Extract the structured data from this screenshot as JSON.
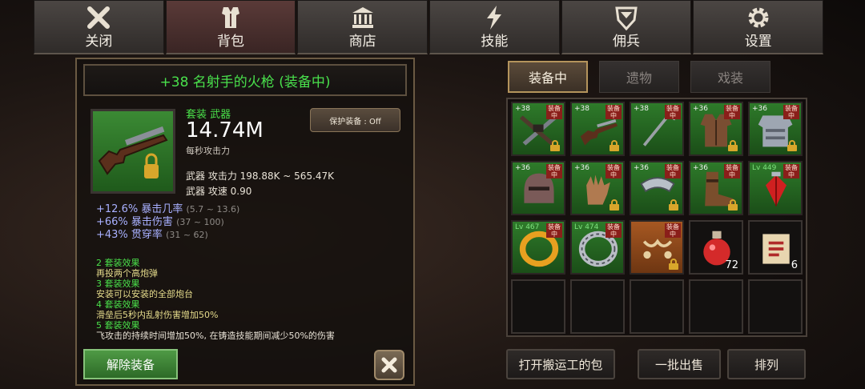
{
  "nav": [
    {
      "label": "关闭",
      "icon": "close-icon"
    },
    {
      "label": "背包",
      "icon": "armor-icon"
    },
    {
      "label": "商店",
      "icon": "temple-icon"
    },
    {
      "label": "技能",
      "icon": "lightning-icon"
    },
    {
      "label": "佣兵",
      "icon": "shield-icon"
    },
    {
      "label": "设置",
      "icon": "gear-icon"
    }
  ],
  "active_nav": "背包",
  "item": {
    "title": "+38 名射手的火枪 (装备中)",
    "set_type": "套装 武器",
    "power": "14.74M",
    "power_label": "每秒攻击力",
    "attack": "武器 攻击力 198.88K ~ 565.47K",
    "speed": "武器 攻速 0.90",
    "protect_label": "保护装备 : Off",
    "substats": [
      {
        "text": "+12.6% 暴击几率",
        "range": "(5.7 ~ 13.6)"
      },
      {
        "text": "+66% 暴击伤害",
        "range": "(37 ~ 100)"
      },
      {
        "text": "+43% 贯穿率",
        "range": "(31 ~ 62)"
      }
    ],
    "set_effects": [
      {
        "title": "2 套装效果",
        "text": "再投两个高炮弹"
      },
      {
        "title": "3 套装效果",
        "text": "安装可以安装的全部炮台"
      },
      {
        "title": "4 套装效果",
        "text": "滑垒后5秒内乱射伤害增加50%"
      },
      {
        "title": "5 套装效果",
        "text": "飞攻击的持续时间增加50%, 在铸造技能期间减少50%的伤害"
      }
    ]
  },
  "buttons": {
    "unequip": "解除装备",
    "open_porter": "打开搬运工的包",
    "bulk_sell": "一批出售",
    "sort": "排列"
  },
  "tabs": [
    {
      "label": "装备中",
      "active": true
    },
    {
      "label": "遗物",
      "active": false
    },
    {
      "label": "戏装",
      "active": false
    }
  ],
  "equipped_tag": "装备中",
  "inventory": [
    {
      "level": "+38",
      "bg": "green",
      "art": "crossed-guns",
      "equipped": true,
      "locked": true
    },
    {
      "level": "+38",
      "bg": "green",
      "art": "musket",
      "equipped": true,
      "locked": true
    },
    {
      "level": "+38",
      "bg": "green",
      "art": "staff",
      "equipped": true,
      "locked": false
    },
    {
      "level": "+36",
      "bg": "green",
      "art": "coat",
      "equipped": true,
      "locked": true
    },
    {
      "level": "+36",
      "bg": "green",
      "art": "plate-armor",
      "equipped": true,
      "locked": true
    },
    {
      "level": "+36",
      "bg": "green",
      "art": "helmet",
      "equipped": true,
      "locked": false
    },
    {
      "level": "+36",
      "bg": "green",
      "art": "gloves",
      "equipped": true,
      "locked": true
    },
    {
      "level": "+36",
      "bg": "green",
      "art": "collar",
      "equipped": true,
      "locked": true
    },
    {
      "level": "+36",
      "bg": "green",
      "art": "boots",
      "equipped": true,
      "locked": true
    },
    {
      "level": "Lv 449",
      "bg": "green",
      "art": "red-gem",
      "equipped": true,
      "locked": false
    },
    {
      "level": "Lv 467",
      "bg": "green",
      "art": "gold-ring",
      "equipped": true,
      "locked": false
    },
    {
      "level": "Lv 474",
      "bg": "green",
      "art": "silver-ring",
      "equipped": true,
      "locked": false
    },
    {
      "level": "",
      "bg": "orange",
      "art": "earrings",
      "equipped": true,
      "locked": true
    },
    {
      "level": "",
      "bg": "empty",
      "art": "potion",
      "equipped": false,
      "locked": false,
      "count": "72"
    },
    {
      "level": "",
      "bg": "empty",
      "art": "scroll",
      "equipped": false,
      "locked": false,
      "count": "6"
    },
    {
      "level": "",
      "bg": "empty",
      "art": "",
      "equipped": false,
      "locked": false
    },
    {
      "level": "",
      "bg": "empty",
      "art": "",
      "equipped": false,
      "locked": false
    },
    {
      "level": "",
      "bg": "empty",
      "art": "",
      "equipped": false,
      "locked": false
    },
    {
      "level": "",
      "bg": "empty",
      "art": "",
      "equipped": false,
      "locked": false
    },
    {
      "level": "",
      "bg": "empty",
      "art": "",
      "equipped": false,
      "locked": false
    }
  ],
  "colors": {
    "accent_green": "#49e04c",
    "substat": "#a8b0ff",
    "set_text": "#e6dc8c",
    "equipped_tag": "#8a1f1a"
  }
}
